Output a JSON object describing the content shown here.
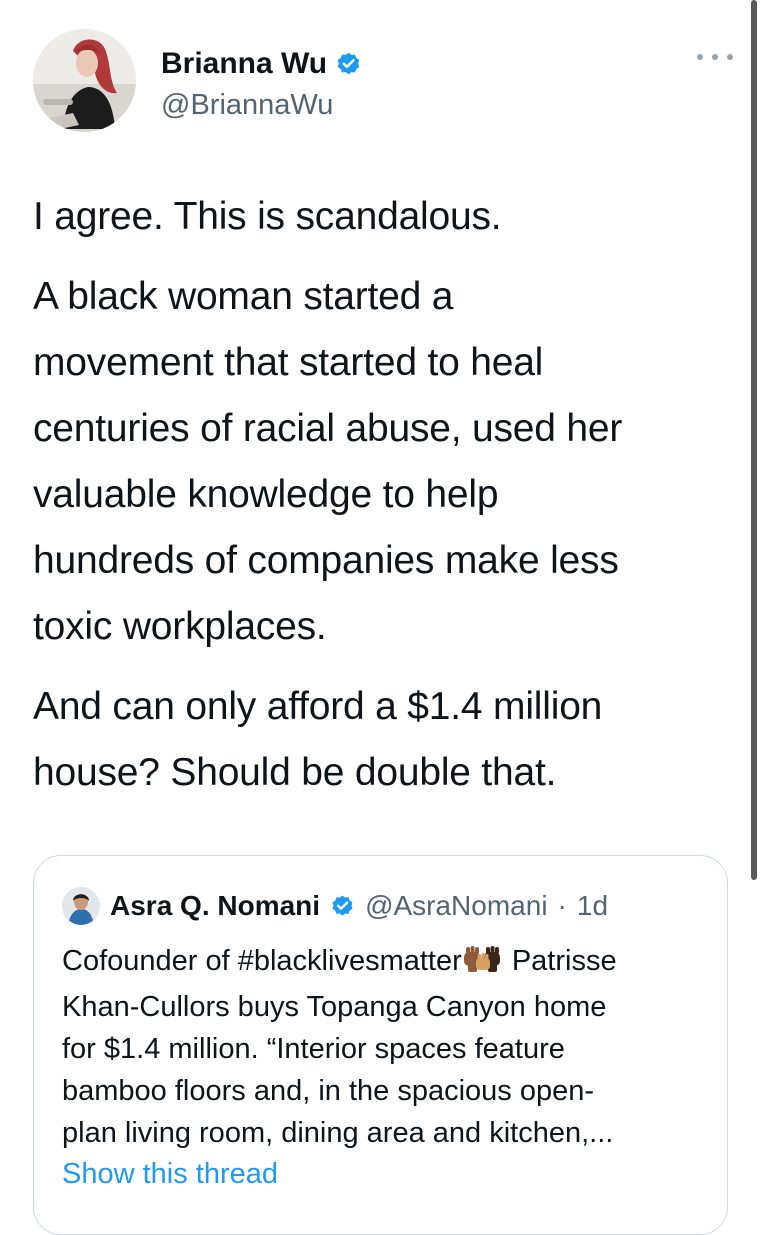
{
  "author": {
    "name": "Brianna Wu",
    "handle": "@BriannaWu",
    "verified": true,
    "avatar_icon": "profile-photo"
  },
  "tweet": {
    "paragraphs": [
      "I agree. This is scandalous.",
      "A black woman started a\nmovement that started to heal\ncenturies of racial abuse, used her\nvaluable knowledge to help\nhundreds of companies make less\ntoxic workplaces.",
      "And can only afford a $1.4 million\nhouse? Should be double that."
    ]
  },
  "quote": {
    "name": "Asra Q. Nomani",
    "handle": "@AsraNomani",
    "separator": "·",
    "time": "1d",
    "verified": true,
    "text_before_emoji": "Cofounder of #blacklivesmatter",
    "emoji_icon": "raised-fists-emoji",
    "text_after_emoji": " Patrisse\nKhan-Cullors buys Topanga Canyon home\nfor $1.4 million. “Interior spaces feature\nbamboo floors and, in the spacious open-\nplan living room, dining area and kitchen,...",
    "show_thread_label": "Show this thread"
  },
  "colors": {
    "text": "#0f1419",
    "secondary": "#536471",
    "link": "#1d9bf0",
    "verified": "#1d9bf0",
    "border": "#cfd9de"
  }
}
